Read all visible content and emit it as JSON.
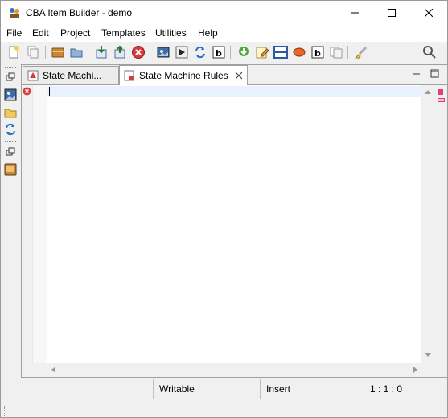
{
  "window": {
    "title": "CBA Item Builder - demo",
    "controls": {
      "minimize": "minimize-icon",
      "maximize": "maximize-icon",
      "close": "close-icon"
    }
  },
  "menu": [
    {
      "label": "File",
      "underline_index": -1
    },
    {
      "label": "Edit",
      "underline_index": -1
    },
    {
      "label": "Project",
      "underline_index": 0
    },
    {
      "label": "Templates",
      "underline_index": 0
    },
    {
      "label": "Utilities",
      "underline_index": 0
    },
    {
      "label": "Help",
      "underline_index": 0
    }
  ],
  "toolbar_icons": [
    "new-file-icon",
    "copy-icon",
    "open-project-icon",
    "open-folder-icon",
    "import-icon",
    "export-icon",
    "stop-icon",
    "picture-icon",
    "run-icon",
    "refresh-icon",
    "text-box-icon",
    "download-arrow-icon",
    "edit-icon",
    "panel-icon",
    "ellipse-icon",
    "text-label-icon",
    "duplicate-icon",
    "brush-icon",
    "search-icon"
  ],
  "left_panel_icons": [
    "restore-icon",
    "picture-icon",
    "folder-icon",
    "refresh-icon",
    "restore-icon",
    "book-icon"
  ],
  "tabs": [
    {
      "label": "State Machi...",
      "icon": "state-machine-icon",
      "active": false
    },
    {
      "label": "State Machine Rules",
      "icon": "rules-document-icon",
      "active": true
    }
  ],
  "editor": {
    "content": "",
    "error_marker": "error-icon"
  },
  "status": {
    "mode": "Writable",
    "insert": "Insert",
    "position": "1 : 1 : 0"
  },
  "colors": {
    "current_line": "#e8f2fe",
    "error_red": "#d83b3b",
    "marker_pink": "#e0407a"
  }
}
